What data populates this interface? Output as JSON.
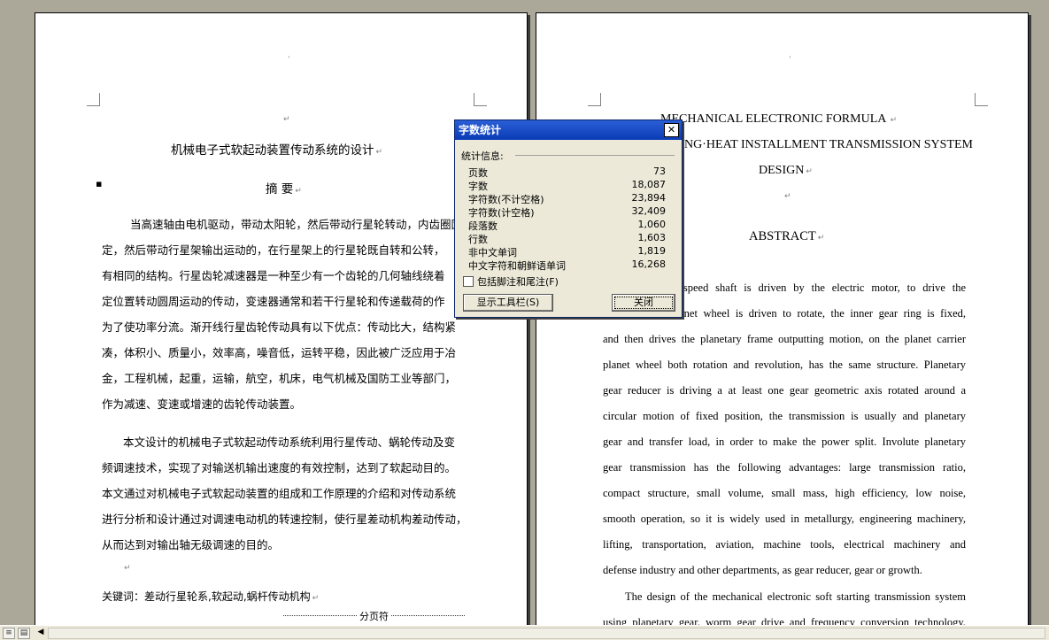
{
  "left_page": {
    "title": "机械电子式软起动装置传动系统的设计",
    "abstract_heading": "摘 要",
    "para1": [
      "当高速轴由电机驱动，带动太阳轮，然后带动行星轮转动，内齿圈固",
      "定，然后带动行星架输出运动的，在行星架上的行星轮既自转和公转，",
      "有相同的结构。行星齿轮减速器是一种至少有一个齿轮的几何轴线绕着",
      "定位置转动圆周运动的传动，变速器通常和若干行星轮和传递载荷的作",
      "为了使功率分流。渐开线行星齿轮传动具有以下优点：传动比大，结构紧",
      "凑，体积小、质量小，效率高，噪音低，运转平稳，因此被广泛应用于冶",
      "金，工程机械，起重，运输，航空，机床，电气机械及国防工业等部门，",
      "作为减速、变速或增速的齿轮传动装置。"
    ],
    "para2": [
      "本文设计的机械电子式软起动传动系统利用行星传动、蜗轮传动及变",
      "频调速技术，实现了对输送机输出速度的有效控制，达到了软起动目的。",
      "本文通过对机械电子式软起动装置的组成和工作原理的介绍和对传动系统",
      "进行分析和设计通过对调速电动机的转速控制，使行星差动机构差动传动，",
      "从而达到对输出轴无级调速的目的。"
    ],
    "keywords": "关键词：差动行星轮系,软起动,蜗杆传动机构",
    "page_break": "分页符"
  },
  "right_page": {
    "title_lines": [
      "MECHANICAL ELECTRONIC FORMULA",
      "STARTING·HEAT INSTALLMENT TRANSMISSION SYSTEM",
      "DESIGN"
    ],
    "abstract_heading": "ABSTRACT",
    "body_lines": [
      "When the high speed shaft is driven by the electric motor, to drive the",
      "sun gear, the planet wheel is driven to rotate, the inner gear ring is fixed,",
      "and then drives the planetary frame outputting motion, on the planet carrier",
      "planet wheel both rotation and revolution, has the same structure. Planetary",
      "gear reducer is driving a at least one gear geometric axis rotated around a",
      "circular motion of fixed position, the transmission is usually and planetary",
      "gear and transfer load, in order to make the power split. Involute planetary",
      "gear transmission has the following advantages: large transmission ratio,",
      "compact structure, small volume, small mass, high efficiency, low noise,",
      "smooth operation, so it is widely used in metallurgy, engineering machinery,",
      "lifting, transportation, aviation, machine tools, electrical machinery and",
      "defense industry and other departments, as gear reducer, gear or growth."
    ],
    "para2_lines": [
      "The design of the mechanical electronic soft starting transmission system",
      "using planetary gear, worm gear drive and frequency conversion technology,"
    ]
  },
  "dialog": {
    "title": "字数统计",
    "group_label": "统计信息:",
    "stats": [
      {
        "label": "页数",
        "value": "73"
      },
      {
        "label": "字数",
        "value": "18,087"
      },
      {
        "label": "字符数(不计空格)",
        "value": "23,894"
      },
      {
        "label": "字符数(计空格)",
        "value": "32,409"
      },
      {
        "label": "段落数",
        "value": "1,060"
      },
      {
        "label": "行数",
        "value": "1,603"
      },
      {
        "label": "非中文单词",
        "value": "1,819"
      },
      {
        "label": "中文字符和朝鲜语单词",
        "value": "16,268"
      }
    ],
    "checkbox_label": "包括脚注和尾注(F)",
    "toolbar_button": "显示工具栏(S)",
    "close_button": "关闭"
  }
}
